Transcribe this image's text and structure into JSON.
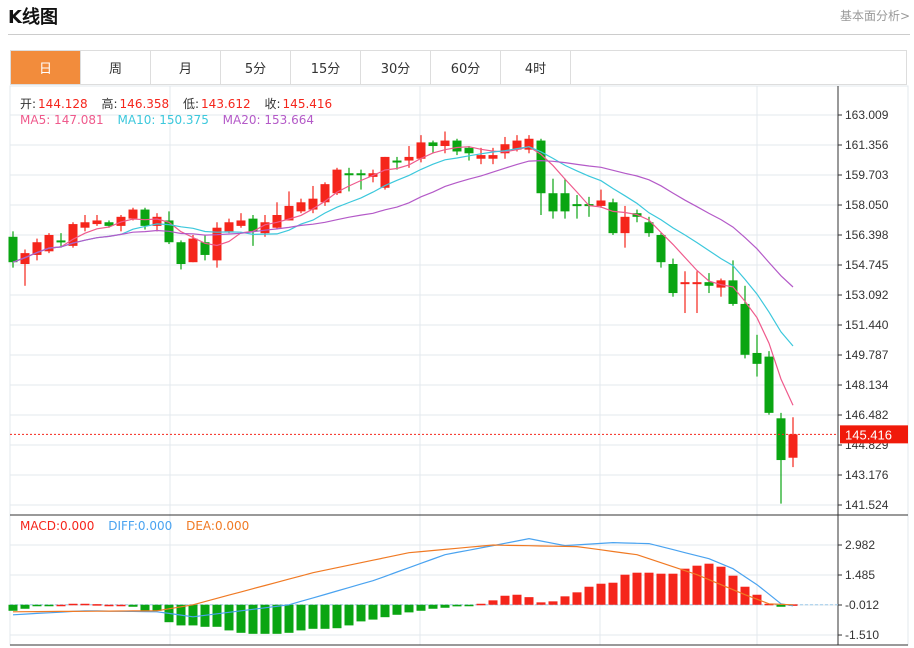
{
  "header": {
    "title": "K线图",
    "link": "基本面分析>"
  },
  "tabs": [
    {
      "label": "日",
      "active": true
    },
    {
      "label": "周"
    },
    {
      "label": "月"
    },
    {
      "label": "5分"
    },
    {
      "label": "15分"
    },
    {
      "label": "30分"
    },
    {
      "label": "60分"
    },
    {
      "label": "4时"
    }
  ],
  "ohlc_info": {
    "open_label": "开:",
    "open": "144.128",
    "high_label": "高:",
    "high": "146.358",
    "low_label": "低:",
    "low": "143.612",
    "close_label": "收:",
    "close": "145.416"
  },
  "ma_info": {
    "ma5": "MA5: 147.081",
    "ma10": "MA10: 150.375",
    "ma20": "MA20: 153.664"
  },
  "macd_info": {
    "macd": "MACD:0.000",
    "diff": "DIFF:0.000",
    "dea": "DEA:0.000"
  },
  "colors": {
    "up": "#f5251b",
    "down": "#0aa512",
    "ma5": "#ef5a8c",
    "ma10": "#3cc8dc",
    "ma20": "#b45ac8",
    "diff": "#4aa3f0",
    "dea": "#f07a24",
    "active_tab": "#f28c3c"
  },
  "chart_data": {
    "type": "candlestick",
    "price_axis_ticks": [
      "163.009",
      "161.356",
      "159.703",
      "158.050",
      "156.398",
      "154.745",
      "153.092",
      "151.440",
      "149.787",
      "148.134",
      "146.482",
      "144.829",
      "143.176",
      "141.524"
    ],
    "price_range": [
      141.524,
      163.009
    ],
    "last_price": "145.416",
    "candles": [
      [
        156.3,
        156.6,
        154.6,
        154.9
      ],
      [
        154.8,
        155.6,
        153.6,
        155.4
      ],
      [
        155.3,
        156.2,
        155.0,
        156.0
      ],
      [
        155.5,
        156.5,
        155.4,
        156.4
      ],
      [
        156.1,
        156.5,
        155.7,
        156.0
      ],
      [
        155.8,
        157.1,
        155.7,
        157.0
      ],
      [
        156.8,
        157.5,
        156.6,
        157.1
      ],
      [
        157.0,
        157.5,
        156.9,
        157.2
      ],
      [
        157.1,
        157.2,
        156.8,
        156.9
      ],
      [
        156.9,
        157.5,
        156.6,
        157.4
      ],
      [
        157.3,
        157.9,
        157.2,
        157.8
      ],
      [
        157.8,
        157.9,
        156.7,
        156.9
      ],
      [
        156.9,
        157.6,
        156.6,
        157.4
      ],
      [
        157.2,
        157.7,
        155.9,
        156.0
      ],
      [
        156.0,
        156.1,
        154.5,
        154.8
      ],
      [
        154.9,
        156.4,
        154.9,
        156.2
      ],
      [
        156.0,
        156.4,
        155.0,
        155.3
      ],
      [
        155.0,
        157.1,
        154.6,
        156.8
      ],
      [
        156.6,
        157.3,
        156.5,
        157.1
      ],
      [
        156.9,
        157.6,
        156.8,
        157.2
      ],
      [
        157.3,
        157.5,
        155.8,
        156.6
      ],
      [
        156.5,
        157.5,
        156.3,
        157.1
      ],
      [
        156.8,
        158.2,
        156.7,
        157.5
      ],
      [
        157.2,
        158.8,
        157.2,
        158.0
      ],
      [
        157.7,
        158.4,
        157.6,
        158.2
      ],
      [
        157.8,
        159.1,
        157.6,
        158.4
      ],
      [
        158.2,
        159.3,
        158.0,
        159.2
      ],
      [
        158.7,
        160.1,
        158.6,
        160.0
      ],
      [
        159.8,
        160.1,
        158.8,
        159.7
      ],
      [
        159.8,
        160.0,
        158.9,
        159.7
      ],
      [
        159.6,
        160.0,
        159.3,
        159.8
      ],
      [
        159.0,
        160.7,
        158.9,
        160.7
      ],
      [
        160.5,
        160.7,
        160.0,
        160.4
      ],
      [
        160.5,
        161.3,
        160.1,
        160.7
      ],
      [
        160.6,
        161.9,
        160.4,
        161.5
      ],
      [
        161.5,
        161.6,
        160.9,
        161.3
      ],
      [
        161.3,
        162.1,
        160.9,
        161.6
      ],
      [
        161.6,
        161.7,
        160.8,
        161.0
      ],
      [
        161.2,
        161.3,
        160.5,
        160.9
      ],
      [
        160.6,
        161.2,
        160.3,
        160.8
      ],
      [
        160.6,
        161.2,
        160.3,
        160.8
      ],
      [
        160.9,
        161.8,
        160.6,
        161.4
      ],
      [
        161.1,
        161.9,
        161.0,
        161.6
      ],
      [
        161.1,
        161.9,
        160.9,
        161.7
      ],
      [
        161.6,
        161.7,
        157.5,
        158.7
      ],
      [
        158.7,
        159.5,
        157.3,
        157.7
      ],
      [
        158.7,
        159.5,
        157.3,
        157.7
      ],
      [
        158.1,
        158.6,
        157.3,
        158.0
      ],
      [
        158.1,
        158.5,
        157.4,
        158.0
      ],
      [
        158.0,
        158.9,
        157.9,
        158.3
      ],
      [
        158.2,
        158.4,
        156.4,
        156.5
      ],
      [
        156.5,
        158.0,
        155.7,
        157.4
      ],
      [
        157.6,
        157.8,
        157.1,
        157.4
      ],
      [
        157.1,
        157.4,
        156.3,
        156.5
      ],
      [
        156.4,
        156.5,
        154.6,
        154.9
      ],
      [
        154.8,
        155.1,
        153.0,
        153.2
      ],
      [
        153.7,
        154.4,
        152.1,
        153.8
      ],
      [
        153.7,
        154.4,
        152.1,
        153.8
      ],
      [
        153.8,
        154.3,
        153.2,
        153.6
      ],
      [
        153.5,
        154.0,
        153.0,
        153.9
      ],
      [
        153.9,
        155.0,
        152.5,
        152.6
      ],
      [
        152.6,
        153.6,
        149.6,
        149.8
      ],
      [
        149.9,
        150.9,
        148.6,
        149.3
      ],
      [
        149.7,
        150.0,
        146.5,
        146.6
      ],
      [
        146.3,
        146.6,
        141.6,
        144.0
      ],
      [
        144.128,
        146.358,
        143.612,
        145.416
      ]
    ],
    "macd_axis_ticks": [
      "2.982",
      "1.485",
      "-0.012",
      "-1.510"
    ],
    "macd_histogram": [
      -0.3,
      -0.2,
      -0.07,
      -0.03,
      0,
      0.05,
      0.05,
      0.03,
      0,
      0,
      -0.1,
      -0.3,
      -0.3,
      -0.87,
      -1.03,
      -1.03,
      -1.1,
      -1.1,
      -1.28,
      -1.4,
      -1.45,
      -1.45,
      -1.45,
      -1.4,
      -1.28,
      -1.2,
      -1.2,
      -1.17,
      -1.03,
      -0.83,
      -0.74,
      -0.62,
      -0.5,
      -0.38,
      -0.3,
      -0.2,
      -0.15,
      -0.08,
      -0.03,
      0.05,
      0.22,
      0.45,
      0.5,
      0.38,
      0.12,
      0.17,
      0.42,
      0.62,
      0.9,
      1.05,
      1.1,
      1.5,
      1.6,
      1.6,
      1.55,
      1.55,
      1.8,
      1.95,
      2.05,
      1.9,
      1.45,
      0.9,
      0.5,
      0.05,
      -0.1,
      0.02
    ],
    "diff_keypoints": [
      [
        0,
        -0.5
      ],
      [
        6,
        -0.3
      ],
      [
        12,
        -0.35
      ],
      [
        15,
        -0.6
      ],
      [
        19,
        -0.3
      ],
      [
        23,
        0
      ],
      [
        30,
        1.2
      ],
      [
        36,
        2.5
      ],
      [
        40,
        2.95
      ],
      [
        43,
        3.3
      ],
      [
        46,
        2.95
      ],
      [
        50,
        3.1
      ],
      [
        53,
        3.05
      ],
      [
        58,
        2.3
      ],
      [
        60,
        1.8
      ],
      [
        62,
        1.0
      ],
      [
        64,
        0.05
      ],
      [
        65,
        -0.05
      ]
    ],
    "dea_keypoints": [
      [
        0,
        -0.35
      ],
      [
        12,
        -0.3
      ],
      [
        15,
        0
      ],
      [
        25,
        1.6
      ],
      [
        33,
        2.6
      ],
      [
        40,
        2.98
      ],
      [
        47,
        2.9
      ],
      [
        52,
        2.5
      ],
      [
        57,
        1.5
      ],
      [
        61,
        0.5
      ],
      [
        63,
        0.05
      ],
      [
        65,
        0
      ]
    ]
  }
}
